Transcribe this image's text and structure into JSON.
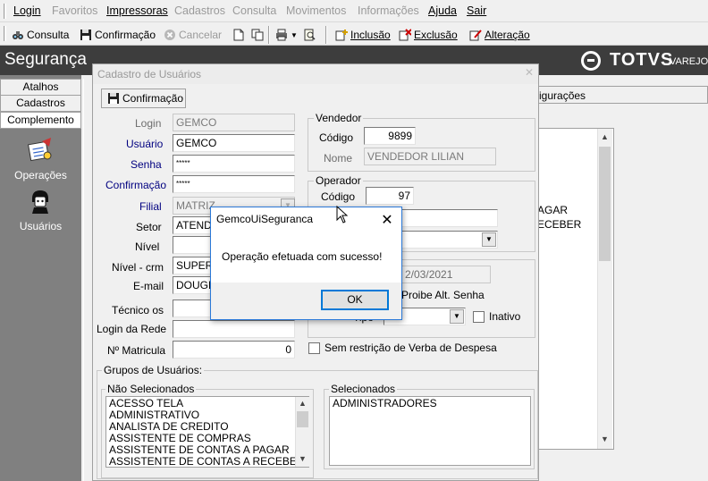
{
  "menu": {
    "login": "Login",
    "favoritos": "Favoritos",
    "impressoras": "Impressoras",
    "cadastros": "Cadastros",
    "consulta": "Consulta",
    "movimentos": "Movimentos",
    "informacoes": "Informações",
    "ajuda": "Ajuda",
    "sair": "Sair"
  },
  "toolbar": {
    "consulta": "Consulta",
    "confirmacao": "Confirmação",
    "cancelar": "Cancelar",
    "inclusao": "Inclusão",
    "exclusao": "Exclusão",
    "alteracao": "Alteração"
  },
  "header": {
    "title": "Segurança",
    "brand": "TOTVS",
    "brand_sub": "VAREJO"
  },
  "nav": {
    "tabs": [
      "Atalhos",
      "Cadastros",
      "Complemento"
    ],
    "items": [
      {
        "label": "Operações",
        "icon": "operations-icon"
      },
      {
        "label": "Usuários",
        "icon": "users-icon"
      }
    ]
  },
  "bg_window": {
    "tab_label": "nfigurações",
    "list_items": [
      "AGAR",
      "ECEBER"
    ]
  },
  "form": {
    "title": "Cadastro de Usuários",
    "confirm_button": "Confirmação",
    "labels": {
      "login": "Login",
      "usuario": "Usuário",
      "senha": "Senha",
      "confirmacao": "Confirmação",
      "filial": "Filial",
      "setor": "Setor",
      "nivel": "Nível",
      "nivel_crm": "Nível - crm",
      "email": "E-mail",
      "tecnico": "Técnico os",
      "login_rede": "Login da Rede",
      "matricula": "Nº Matricula"
    },
    "values": {
      "login": "GEMCO",
      "usuario": "GEMCO",
      "senha": "*****",
      "confirmacao": "*****",
      "filial": "MATRIZ",
      "setor": "ATENDI",
      "nivel": "",
      "nivel_crm": "SUPERV",
      "email": "DOUGLA",
      "tecnico": "",
      "login_rede": "",
      "matricula": "0"
    },
    "vendedor": {
      "title": "Vendedor",
      "codigo_label": "Código",
      "codigo": "9899",
      "nome_label": "Nome",
      "nome": "VENDEDOR LILIAN"
    },
    "operador": {
      "title": "Operador",
      "codigo_label": "Código",
      "codigo": "97"
    },
    "date_value": "2/03/2021",
    "proibe_label": "Proibe Alt. Senha",
    "tipo_label": "Tipo",
    "inativo_label": "Inativo",
    "sem_restricao_label": "Sem restrição de Verba de Despesa",
    "grupos": {
      "title": "Grupos de Usuários:",
      "nao_selecionados_title": "Não Selecionados",
      "selecionados_title": "Selecionados",
      "nao_selecionados": [
        "ACESSO TELA",
        "ADMINISTRATIVO",
        "ANALISTA DE CREDITO",
        "ASSISTENTE DE COMPRAS",
        "ASSISTENTE DE CONTAS A PAGAR",
        "ASSISTENTE DE CONTAS A RECEBER"
      ],
      "selecionados": [
        "ADMINISTRADORES"
      ]
    }
  },
  "dialog": {
    "title": "GemcoUiSeguranca",
    "message": "Operação efetuada com sucesso!",
    "ok": "OK"
  },
  "colors": {
    "header_bg": "#3d3d3d",
    "nav_bg": "#808080",
    "dialog_border": "#2b79d8",
    "label_blue": "#000080"
  }
}
